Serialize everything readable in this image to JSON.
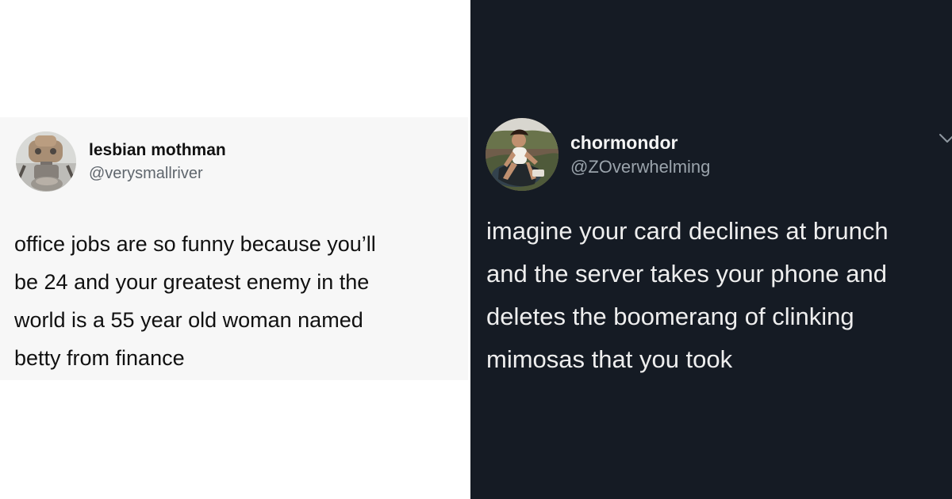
{
  "left_tweet": {
    "display_name": "lesbian mothman",
    "handle": "@verysmallriver",
    "text_lines": [
      "office jobs are so funny because you’ll",
      "be 24 and your greatest enemy in the",
      "world is a 55 year old woman named",
      "betty from finance"
    ],
    "theme": "light"
  },
  "right_tweet": {
    "display_name": "chormondor",
    "handle": "@ZOverwhelming",
    "text_lines": [
      "imagine your card declines at brunch",
      "and the server takes your phone and",
      "deletes the boomerang of clinking",
      "mimosas that you took"
    ],
    "theme": "dark"
  },
  "icons": {
    "tweet_menu": "chevron-down-icon"
  },
  "colors": {
    "light_background": "#ffffff",
    "light_card": "#f7f7f7",
    "dark_background": "#151b24",
    "light_text": "#111111",
    "light_handle": "#5f666d",
    "dark_text": "#eeeeee",
    "dark_handle": "#9aa3ab"
  }
}
